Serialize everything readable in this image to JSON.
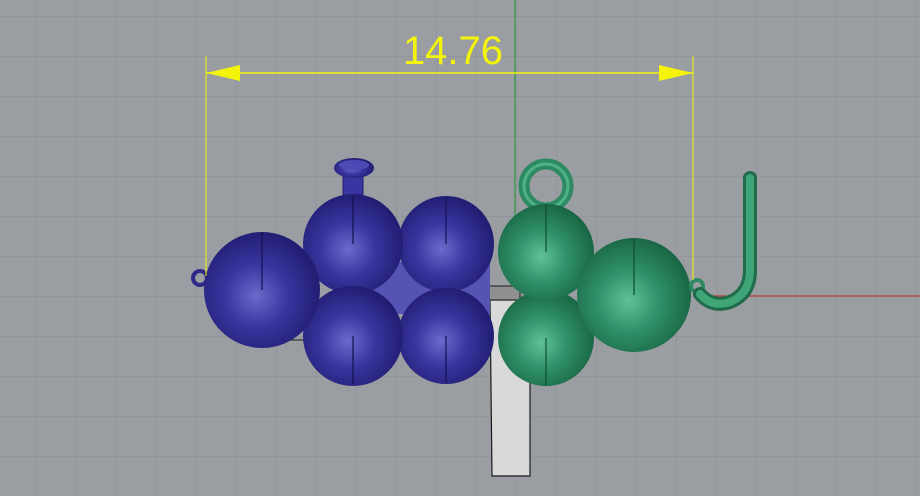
{
  "viewport": {
    "background": "#9a9ea3",
    "grid_color": "#8a8e93",
    "axis_x_color": "#b43a2e",
    "axis_y_color": "#2f9a3a"
  },
  "dimension": {
    "label": "14.76",
    "color": "#f4f40a"
  },
  "objects": {
    "left_cluster_color": "#2f2a8a",
    "right_cluster_color": "#2d8a63",
    "hook_color": "#2d8a63",
    "stand_color": "#d9d9d9"
  }
}
